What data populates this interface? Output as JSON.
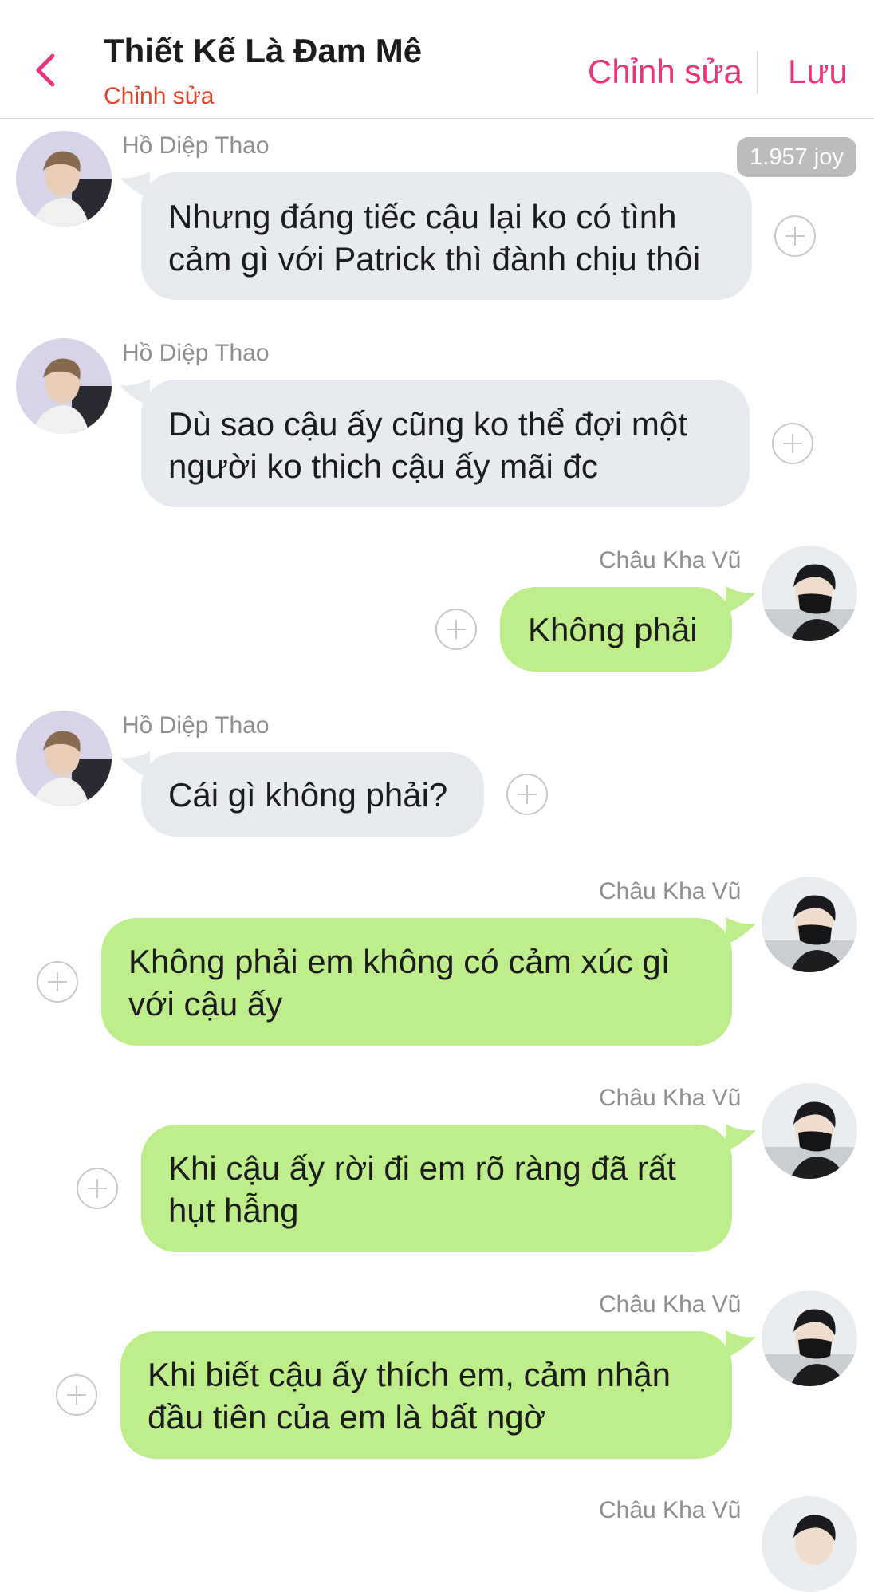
{
  "header": {
    "title": "Thiết Kế Là Đam Mê",
    "subtitle": "Chỉnh sửa",
    "edit_label": "Chỉnh sửa",
    "save_label": "Lưu",
    "accent_color": "#e8357b",
    "subtitle_color": "#e5402a"
  },
  "badge": "1.957 joy",
  "messages": [
    {
      "sender": "Hồ Diệp Thao",
      "side": "left",
      "lines": [
        "Nhưng đáng tiếc cậu lại ko có tình",
        "cảm gì với Patrick thì đành chịu thôi"
      ]
    },
    {
      "sender": "Hồ Diệp Thao",
      "side": "left",
      "lines": [
        "Dù sao cậu ấy cũng ko thể đợi một",
        "người ko thich cậu ấy mãi đc"
      ]
    },
    {
      "sender": "Châu Kha Vũ",
      "side": "right",
      "lines": [
        "Không phải"
      ]
    },
    {
      "sender": "Hồ Diệp Thao",
      "side": "left",
      "lines": [
        "Cái gì không phải?"
      ]
    },
    {
      "sender": "Châu Kha Vũ",
      "side": "right",
      "lines": [
        "Không phải em không có cảm xúc gì",
        "với cậu ấy"
      ]
    },
    {
      "sender": "Châu Kha Vũ",
      "side": "right",
      "lines": [
        "Khi cậu ấy rời đi em rõ ràng đã rất",
        "hụt hẫng"
      ]
    },
    {
      "sender": "Châu Kha Vũ",
      "side": "right",
      "lines": [
        "Khi biết cậu ấy thích em, cảm nhận",
        "đầu tiên của em là bất ngờ"
      ]
    },
    {
      "sender": "Châu Kha Vũ",
      "side": "right",
      "lines": []
    }
  ],
  "colors": {
    "incoming_bubble": "#e7eaee",
    "outgoing_bubble": "#bdee8b"
  },
  "icons": [
    "chevron-left-icon",
    "add-reaction-icon"
  ]
}
